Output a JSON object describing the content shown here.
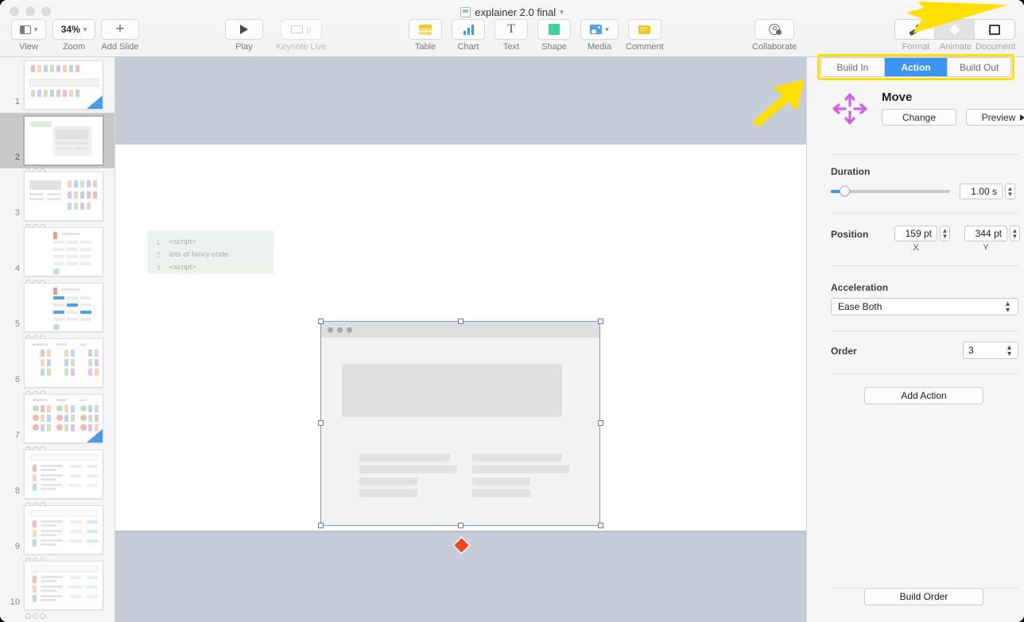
{
  "window": {
    "title": "explainer 2.0 final",
    "title_icon": "keynote-document-icon",
    "menu_chevron": "chevron-down-icon"
  },
  "toolbar": {
    "left": [
      {
        "label": "View",
        "icon": "view-panes-icon",
        "chevron": "chevron-down-icon"
      },
      {
        "label": "Zoom",
        "icon": "zoom-value",
        "value": "34%",
        "chevron": "chevron-down-icon"
      },
      {
        "label": "Add Slide",
        "icon": "plus-icon"
      }
    ],
    "play": {
      "label": "Play",
      "icon": "play-triangle-icon"
    },
    "keynote_live": {
      "label": "Keynote Live",
      "icon": "display-audio-icon",
      "disabled": true
    },
    "center": [
      {
        "label": "Table",
        "icon": "table-icon"
      },
      {
        "label": "Chart",
        "icon": "bar-chart-icon"
      },
      {
        "label": "Text",
        "icon": "text-t-icon"
      },
      {
        "label": "Shape",
        "icon": "shape-square-icon"
      },
      {
        "label": "Media",
        "icon": "media-photo-icon",
        "chevron": "chevron-down-icon"
      },
      {
        "label": "Comment",
        "icon": "comment-flag-icon"
      }
    ],
    "collaborate": {
      "label": "Collaborate",
      "icon": "collaborate-person-icon"
    },
    "inspector_segments": [
      {
        "label": "Format",
        "icon": "paintbrush-icon",
        "selected": false
      },
      {
        "label": "Animate",
        "icon": "diamond-icon",
        "selected": true
      },
      {
        "label": "Document",
        "icon": "document-rect-icon",
        "selected": false
      }
    ]
  },
  "sidebar": {
    "slides": [
      {
        "number": "1",
        "selected": false,
        "builds": 3,
        "corner_flag": true,
        "kind": "people-headline"
      },
      {
        "number": "2",
        "selected": true,
        "builds": 3,
        "corner_flag": false,
        "kind": "browser-mock"
      },
      {
        "number": "3",
        "selected": false,
        "builds": 3,
        "corner_flag": false,
        "kind": "mock-plus-people"
      },
      {
        "number": "4",
        "selected": false,
        "builds": 3,
        "corner_flag": false,
        "kind": "profile-list"
      },
      {
        "number": "5",
        "selected": false,
        "builds": 3,
        "corner_flag": false,
        "kind": "profile-list-highlight"
      },
      {
        "number": "6",
        "selected": false,
        "builds": 3,
        "corner_flag": false,
        "kind": "three-columns"
      },
      {
        "number": "7",
        "selected": false,
        "builds": 3,
        "corner_flag": true,
        "kind": "three-columns-marked"
      },
      {
        "number": "8",
        "selected": false,
        "builds": 3,
        "corner_flag": false,
        "kind": "table-rows"
      },
      {
        "number": "9",
        "selected": false,
        "builds": 3,
        "corner_flag": false,
        "kind": "table-rows-blue"
      },
      {
        "number": "10",
        "selected": false,
        "builds": 3,
        "corner_flag": false,
        "kind": "table-rows-cost"
      }
    ],
    "column_headers": [
      "WEBSITES",
      "PAGES",
      "ADS"
    ]
  },
  "canvas": {
    "code_block": {
      "line_numbers": [
        "1",
        "2",
        "3"
      ],
      "lines": [
        "<script>",
        "lots of fancy code",
        "<script>"
      ]
    },
    "browser_mock": {
      "name": "browser-window-mockup",
      "dots": 3,
      "selected": true,
      "handles": 8
    },
    "motion_marker": {
      "name": "motion-path-endpoint",
      "color": "#ef4723"
    }
  },
  "inspector": {
    "tabs": [
      {
        "label": "Build In",
        "selected": false
      },
      {
        "label": "Action",
        "selected": true
      },
      {
        "label": "Build Out",
        "selected": false
      }
    ],
    "animation": {
      "name": "Move",
      "icon": "move-four-arrows-icon",
      "icon_color": "#d060dd",
      "change_label": "Change",
      "preview_label": "Preview",
      "preview_icon": "play-triangle-icon"
    },
    "duration": {
      "label": "Duration",
      "value": "1.00 s",
      "slider_percent": 12
    },
    "position": {
      "label": "Position",
      "x_value": "159 pt",
      "y_value": "344 pt",
      "x_axis_label": "X",
      "y_axis_label": "Y"
    },
    "acceleration": {
      "label": "Acceleration",
      "value": "Ease Both"
    },
    "order": {
      "label": "Order",
      "value": "3"
    },
    "add_action_label": "Add Action",
    "build_order_label": "Build Order"
  },
  "annotations": {
    "arrow_color": "#ffe000",
    "highlight_color": "#ffe000",
    "arrows": [
      {
        "name": "arrow-pointing-to-animate-button"
      },
      {
        "name": "arrow-pointing-to-action-tab"
      }
    ]
  },
  "colors": {
    "accent_blue": "#3b95f4",
    "canvas_backdrop": "#c5cdd8",
    "selection_blue": "#6b9fe0",
    "marker_red": "#ef4723",
    "move_icon_purple": "#d060dd"
  }
}
